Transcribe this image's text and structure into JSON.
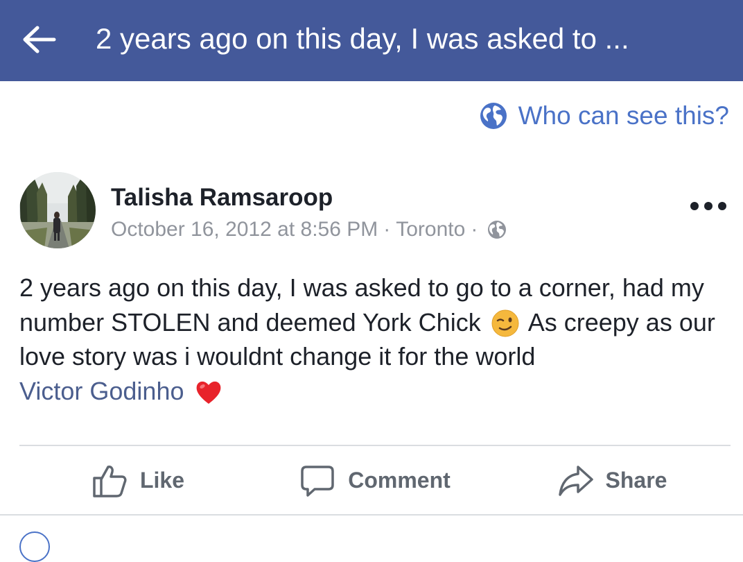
{
  "header": {
    "back_icon": "back-arrow-icon",
    "title": "2 years ago on this day, I was asked to ..."
  },
  "privacy": {
    "icon": "globe-icon",
    "label": "Who can see this?"
  },
  "post": {
    "author": "Talisha Ramsaroop",
    "timestamp": "October 16, 2012 at 8:56 PM",
    "separator": "·",
    "location": "Toronto",
    "audience_icon": "public-globe-icon",
    "more_icon": "more-options-icon",
    "text_part1": "2 years ago on this day, I was asked to go to a corner, had my number STOLEN and deemed York Chick",
    "emoji1": "winking-face-emoji",
    "text_part2": "As creepy as our love story was i wouldnt change it for the world",
    "mention": "Victor Godinho",
    "emoji2": "red-heart-emoji"
  },
  "actions": {
    "like": "Like",
    "comment": "Comment",
    "share": "Share"
  },
  "colors": {
    "header_bg": "#44599a",
    "link_blue": "#4a72c7",
    "mention": "#4b5e8e",
    "meta_grey": "#90949c",
    "action_grey": "#606770"
  }
}
